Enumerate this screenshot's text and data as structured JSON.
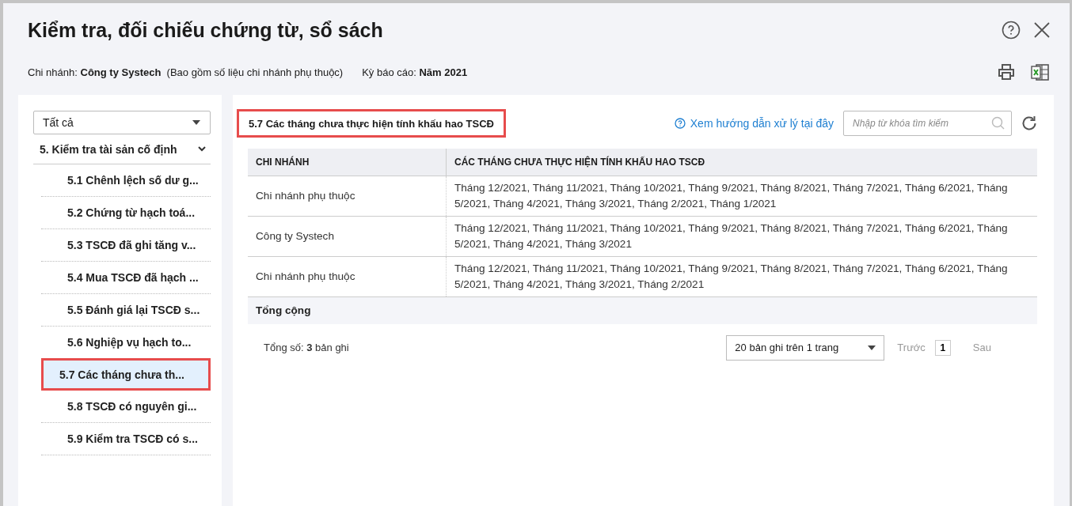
{
  "window": {
    "title": "Kiểm tra, đối chiếu chứng từ, sổ sách"
  },
  "info": {
    "branch_label": "Chi nhánh:",
    "branch_value": "Công ty Systech",
    "branch_note": "(Bao gồm số liệu chi nhánh phụ thuộc)",
    "period_label": "Kỳ báo cáo:",
    "period_value": "Năm 2021"
  },
  "sidebar": {
    "filter": "Tất cả",
    "group": {
      "label": "5. Kiểm tra tài sản cố định",
      "expanded": true
    },
    "items": [
      {
        "label": "5.1 Chênh lệch số dư g...",
        "selected": false
      },
      {
        "label": "5.2 Chứng từ hạch toá...",
        "selected": false
      },
      {
        "label": "5.3 TSCĐ đã ghi tăng v...",
        "selected": false
      },
      {
        "label": "5.4 Mua TSCĐ đã hạch ...",
        "selected": false
      },
      {
        "label": "5.5 Đánh giá lại TSCĐ s...",
        "selected": false
      },
      {
        "label": "5.6 Nghiệp vụ hạch to...",
        "selected": false
      },
      {
        "label": "5.7 Các tháng chưa th...",
        "selected": true
      },
      {
        "label": "5.8 TSCĐ có nguyên gi...",
        "selected": false
      },
      {
        "label": "5.9 Kiểm tra TSCĐ có s...",
        "selected": false
      }
    ]
  },
  "report": {
    "title": "5.7 Các tháng chưa thực hiện tính khấu hao TSCĐ",
    "help_link": "Xem hướng dẫn xử lý tại đây",
    "search": {
      "placeholder": "Nhập từ khóa tìm kiếm"
    }
  },
  "table": {
    "columns": [
      "CHI NHÁNH",
      "CÁC THÁNG CHƯA THỰC HIỆN TÍNH KHẤU HAO TSCĐ"
    ],
    "rows": [
      [
        "Chi nhánh phụ thuộc",
        "Tháng 12/2021, Tháng 11/2021, Tháng 10/2021, Tháng 9/2021, Tháng 8/2021, Tháng 7/2021, Tháng 6/2021, Tháng 5/2021, Tháng 4/2021, Tháng 3/2021, Tháng 2/2021, Tháng 1/2021"
      ],
      [
        "Công ty Systech",
        "Tháng 12/2021, Tháng 11/2021, Tháng 10/2021, Tháng 9/2021, Tháng 8/2021, Tháng 7/2021, Tháng 6/2021, Tháng 5/2021, Tháng 4/2021, Tháng 3/2021"
      ],
      [
        "Chi nhánh phụ thuộc",
        "Tháng 12/2021, Tháng 11/2021, Tháng 10/2021, Tháng 9/2021, Tháng 8/2021, Tháng 7/2021, Tháng 6/2021, Tháng 5/2021, Tháng 4/2021, Tháng 3/2021, Tháng 2/2021"
      ]
    ],
    "total_label": "Tổng cộng"
  },
  "footer": {
    "count_label": "Tổng số:",
    "count": "3",
    "count_unit": "bản ghi",
    "page_size": "20 bản ghi trên 1 trang",
    "prev": {
      "label": "Trước",
      "disabled": true
    },
    "pages": [
      {
        "label": "1",
        "selected": true
      }
    ],
    "next": {
      "label": "Sau",
      "disabled": true
    }
  }
}
